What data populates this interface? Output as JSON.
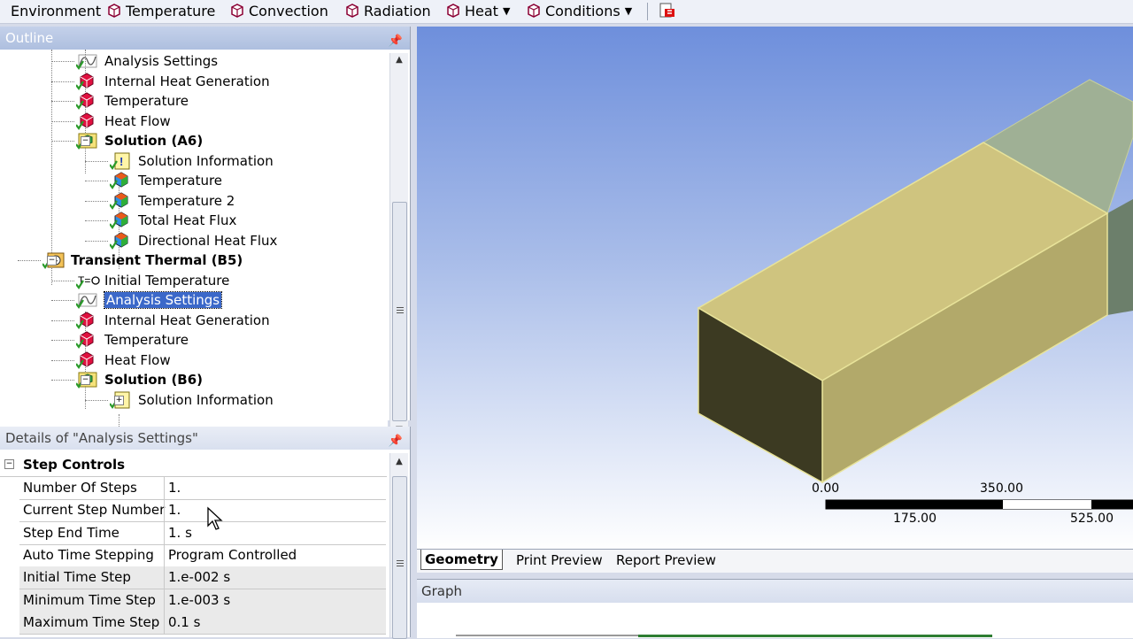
{
  "toolbar": {
    "items": [
      {
        "label": "Environment",
        "icon": "none"
      },
      {
        "label": "Temperature",
        "icon": "load-cube-icon"
      },
      {
        "label": "Convection",
        "icon": "load-cube-icon"
      },
      {
        "label": "Radiation",
        "icon": "load-cube-icon"
      },
      {
        "label": "Heat",
        "icon": "load-cube-icon",
        "dropdown": true
      },
      {
        "label": "Conditions",
        "icon": "load-cube-icon",
        "dropdown": true
      }
    ]
  },
  "outline": {
    "title": "Outline",
    "tree": [
      {
        "label": "Analysis Settings",
        "icon": "analysis-settings-icon",
        "bold": false
      },
      {
        "label": "Internal Heat Generation",
        "icon": "load-cube-icon",
        "bold": false
      },
      {
        "label": "Temperature",
        "icon": "load-cube-icon",
        "bold": false
      },
      {
        "label": "Heat Flow",
        "icon": "load-cube-icon",
        "bold": false
      },
      {
        "label": "Solution (A6)",
        "icon": "solution-icon",
        "bold": true
      },
      {
        "label": "Solution Information",
        "icon": "solution-info-icon",
        "bold": false
      },
      {
        "label": "Temperature",
        "icon": "result-icon",
        "bold": false
      },
      {
        "label": "Temperature 2",
        "icon": "result-icon",
        "bold": false
      },
      {
        "label": "Total Heat Flux",
        "icon": "result-icon",
        "bold": false
      },
      {
        "label": "Directional Heat Flux",
        "icon": "result-icon",
        "bold": false
      },
      {
        "label": "Transient Thermal (B5)",
        "icon": "transient-thermal-icon",
        "bold": true
      },
      {
        "label": "Initial Temperature",
        "icon": "initial-temperature-icon",
        "bold": false
      },
      {
        "label": "Analysis Settings",
        "icon": "analysis-settings-icon",
        "bold": false,
        "selected": true
      },
      {
        "label": "Internal Heat Generation",
        "icon": "load-cube-icon",
        "bold": false
      },
      {
        "label": "Temperature",
        "icon": "load-cube-icon",
        "bold": false
      },
      {
        "label": "Heat Flow",
        "icon": "load-cube-icon",
        "bold": false
      },
      {
        "label": "Solution (B6)",
        "icon": "solution-icon",
        "bold": true
      },
      {
        "label": "Solution Information",
        "icon": "solution-info-icon",
        "bold": false
      }
    ]
  },
  "details": {
    "title": "Details of \"Analysis Settings\"",
    "group": "Step Controls",
    "rows": [
      {
        "key": "Number Of Steps",
        "value": "1."
      },
      {
        "key": "Current Step Number",
        "value": "1."
      },
      {
        "key": "Step End Time",
        "value": "1. s"
      },
      {
        "key": "Auto Time Stepping",
        "value": "Program Controlled"
      },
      {
        "key": "Initial Time Step",
        "value": "1.e-002 s"
      },
      {
        "key": "Minimum Time Step",
        "value": "1.e-003 s"
      },
      {
        "key": "Maximum Time Step",
        "value": "0.1 s"
      }
    ]
  },
  "viewport": {
    "scale_top": [
      "0.00",
      "350.00"
    ],
    "scale_bottom": [
      "175.00",
      "525.00"
    ]
  },
  "tabs": {
    "items": [
      "Geometry",
      "Print Preview",
      "Report Preview"
    ],
    "active": "Geometry"
  },
  "graph": {
    "title": "Graph"
  },
  "colors": {
    "selection": "#3b68c9",
    "panel_title": "#aebfdf",
    "geometry_face": "#cfc47f",
    "geometry_dark": "#3c3a22"
  }
}
